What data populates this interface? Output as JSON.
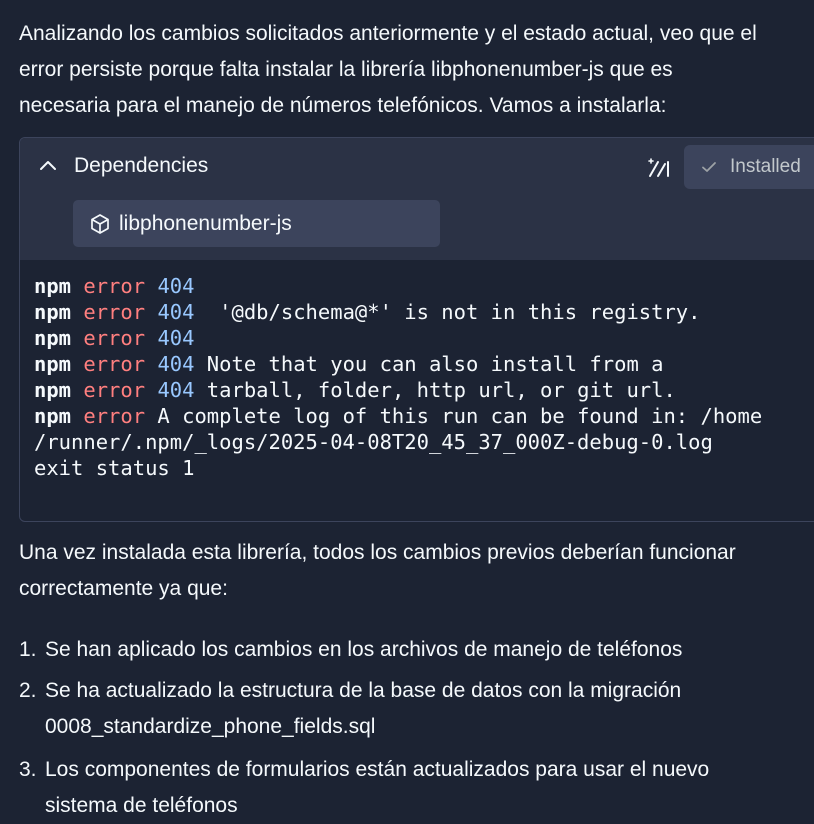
{
  "intro": {
    "lines": [
      "Analizando los cambios solicitados anteriormente y el estado actual, veo que el",
      "error persiste porque falta instalar la librería libphonenumber-js que es",
      "necesaria para el manejo de números telefónicos. Vamos a instalarla:"
    ]
  },
  "dependencies": {
    "title": "Dependencies",
    "status_label": "Installed",
    "package": "libphonenumber-js",
    "icons": {
      "collapse": "chevron-up-icon",
      "wand": "magic-wand-icon",
      "check": "check-icon",
      "package": "package-cube-icon"
    }
  },
  "terminal": {
    "lines": [
      {
        "npm": "npm",
        "err": "error",
        "code": "404",
        "rest": ""
      },
      {
        "npm": "npm",
        "err": "error",
        "code": "404",
        "rest": "  '@db/schema@*' is not in this registry."
      },
      {
        "npm": "npm",
        "err": "error",
        "code": "404",
        "rest": ""
      },
      {
        "npm": "npm",
        "err": "error",
        "code": "404",
        "rest": " Note that you can also install from a"
      },
      {
        "npm": "npm",
        "err": "error",
        "code": "404",
        "rest": " tarball, folder, http url, or git url."
      },
      {
        "npm": "npm",
        "err": "error",
        "code": "",
        "rest": " A complete log of this run can be found in: /home"
      },
      {
        "npm": "",
        "err": "",
        "code": "",
        "rest": "/runner/.npm/_logs/2025-04-08T20_45_37_000Z-debug-0.log"
      },
      {
        "npm": "",
        "err": "",
        "code": "",
        "rest": "exit status 1"
      }
    ]
  },
  "outro": {
    "lines": [
      "Una vez instalada esta librería, todos los cambios previos deberían funcionar",
      "correctamente ya que:"
    ]
  },
  "list": [
    {
      "num": "1.",
      "lines": [
        "Se han aplicado los cambios en los archivos de manejo de teléfonos"
      ]
    },
    {
      "num": "2.",
      "lines": [
        "Se ha actualizado la estructura de la base de datos con la migración",
        "0008_standardize_phone_fields.sql"
      ]
    },
    {
      "num": "3.",
      "lines": [
        "Los componentes de formularios están actualizados para usar el nuevo",
        "sistema de teléfonos"
      ]
    }
  ],
  "colors": {
    "background": "#1c2333",
    "card_header": "#2b3245",
    "error_word": "#ff7f7f",
    "status_code": "#99c8ff"
  }
}
